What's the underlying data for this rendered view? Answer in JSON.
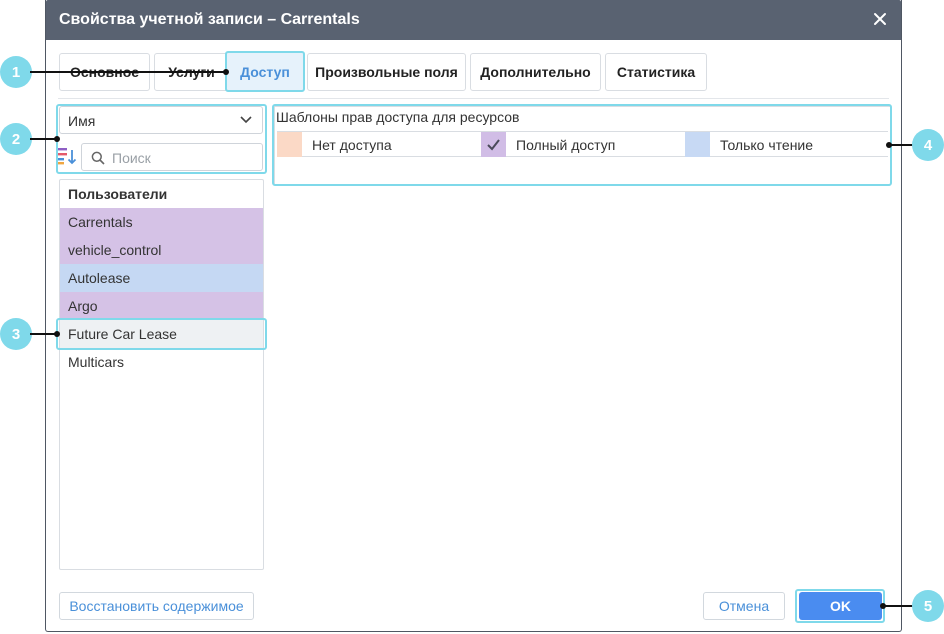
{
  "dialog": {
    "title": "Свойства учетной записи – Carrentals"
  },
  "tabs": [
    {
      "label": "Основное",
      "active": false
    },
    {
      "label": "Услуги",
      "active": false
    },
    {
      "label": "Доступ",
      "active": true
    },
    {
      "label": "Произвольные поля",
      "active": false
    },
    {
      "label": "Дополнительно",
      "active": false
    },
    {
      "label": "Статистика",
      "active": false
    }
  ],
  "filter": {
    "sort_value": "Имя",
    "search_placeholder": "Поиск"
  },
  "users": {
    "header": "Пользователи",
    "items": [
      {
        "name": "Carrentals",
        "access": "full"
      },
      {
        "name": "vehicle_control",
        "access": "full"
      },
      {
        "name": "Autolease",
        "access": "read"
      },
      {
        "name": "Argo",
        "access": "full"
      },
      {
        "name": "Future Car Lease",
        "access": "selected"
      },
      {
        "name": "Multicars",
        "access": "none"
      }
    ]
  },
  "templates": {
    "title": "Шаблоны прав доступа для ресурсов",
    "legend": [
      {
        "label": "Нет доступа",
        "color": "#fbd9c6"
      },
      {
        "label": "Полный доступ",
        "color": "#d1bde6",
        "checked": true
      },
      {
        "label": "Только чтение",
        "color": "#c7d9f4"
      }
    ]
  },
  "footer": {
    "restore_label": "Восстановить содержимое",
    "cancel_label": "Отмена",
    "ok_label": "OK"
  },
  "callouts": [
    "1",
    "2",
    "3",
    "4",
    "5"
  ],
  "colors": {
    "titlebar": "#596271",
    "accent": "#4a90d9",
    "ok_button": "#4a8cf0",
    "highlight": "#7fd9ea",
    "row_full": "#d5c2e6",
    "row_read": "#c5d8f3",
    "row_selected": "#eef1f3"
  }
}
